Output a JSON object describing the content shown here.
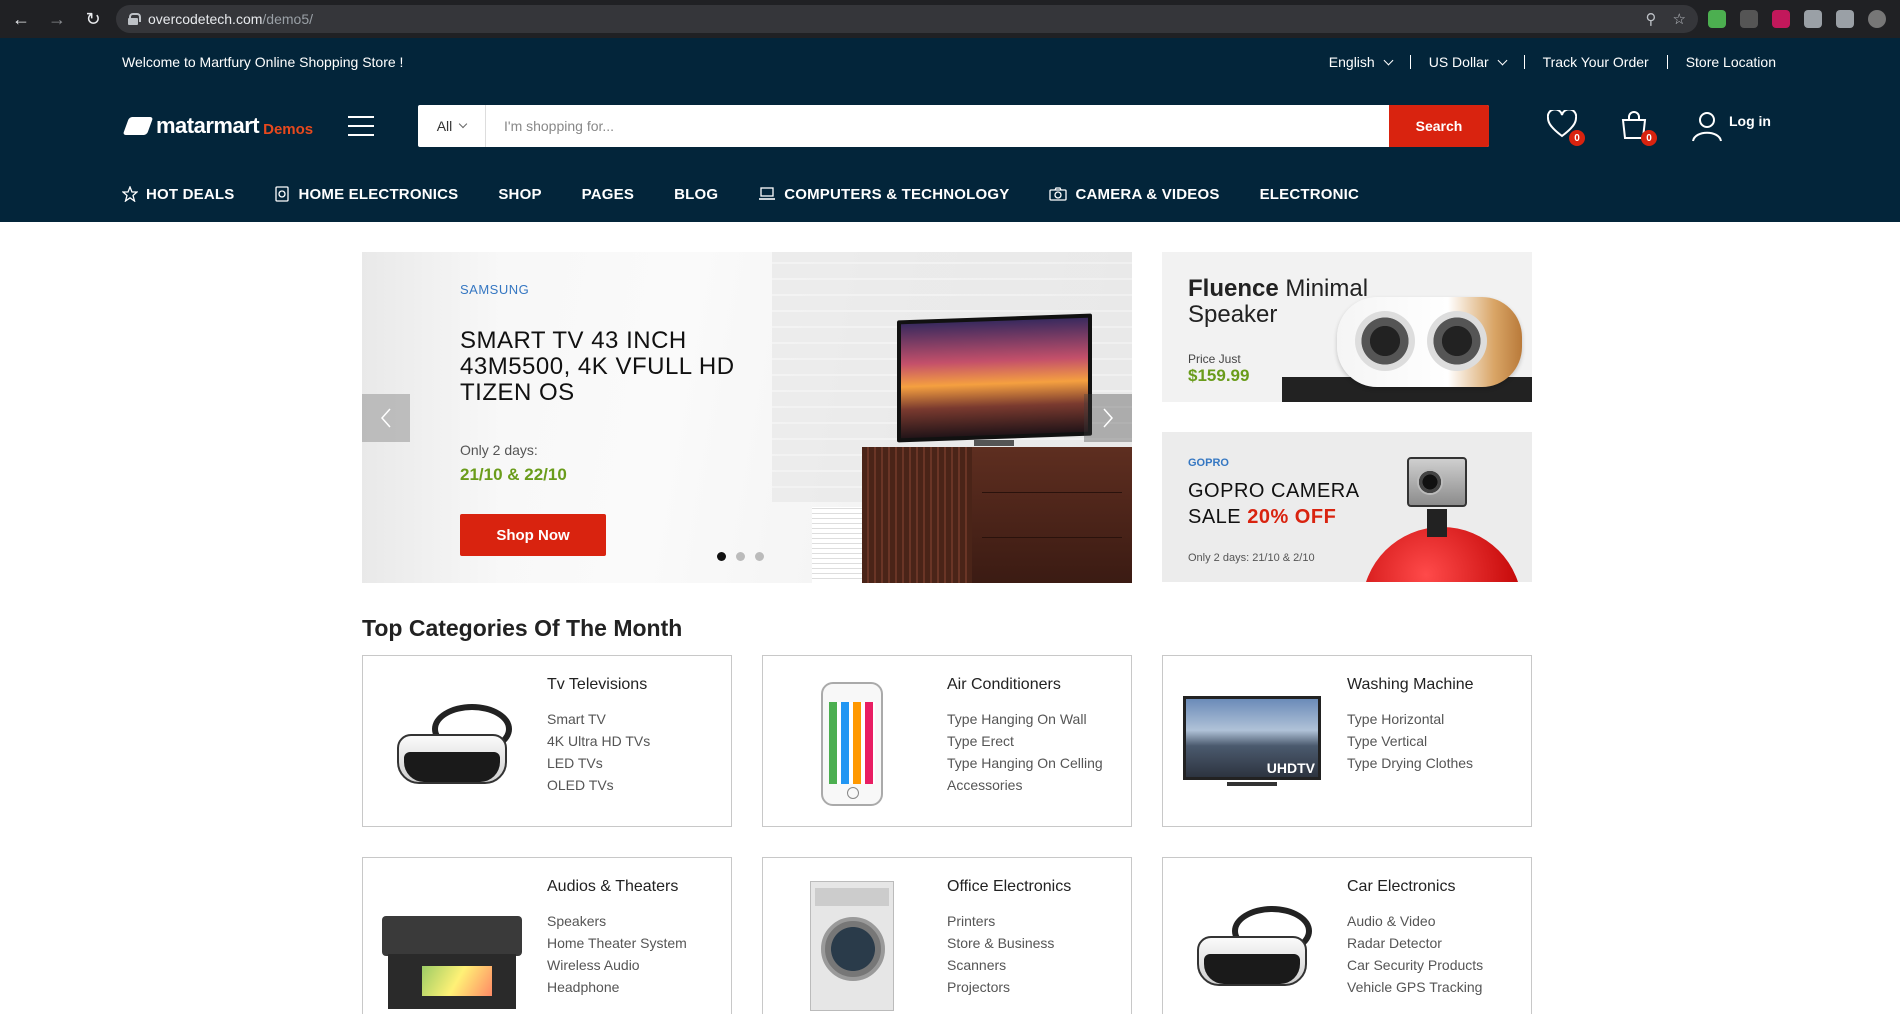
{
  "browser": {
    "url_host": "overcodetech.com",
    "url_path": "/demo5/"
  },
  "topbar": {
    "welcome": "Welcome to Martfury Online Shopping Store !",
    "language": "English",
    "currency": "US Dollar",
    "track": "Track Your Order",
    "store": "Store Location"
  },
  "header": {
    "logo_text": "matarmart",
    "logo_suffix": "Demos",
    "search_category": "All",
    "search_placeholder": "I'm shopping for...",
    "search_button": "Search",
    "wishlist_count": "0",
    "cart_count": "0",
    "login": "Log in"
  },
  "nav": [
    {
      "label": "HOT DEALS",
      "icon": "star-icon"
    },
    {
      "label": "HOME ELECTRONICS",
      "icon": "device-icon"
    },
    {
      "label": "SHOP",
      "icon": ""
    },
    {
      "label": "PAGES",
      "icon": ""
    },
    {
      "label": "BLOG",
      "icon": ""
    },
    {
      "label": "COMPUTERS & TECHNOLOGY",
      "icon": "laptop-icon"
    },
    {
      "label": "CAMERA & VIDEOS",
      "icon": "camera-icon"
    },
    {
      "label": "ELECTRONIC",
      "icon": ""
    }
  ],
  "hero": {
    "brand": "SAMSUNG",
    "title": "SMART TV 43 INCH 43M5500, 4K VFULL HD TIZEN OS",
    "only": "Only 2 days:",
    "dates": "21/10 & 22/10",
    "button": "Shop Now"
  },
  "promo1": {
    "title_bold": "Fluence",
    "title_rest": " Minimal Speaker",
    "price_label": "Price Just",
    "price": "$159.99"
  },
  "promo2": {
    "brand": "GOPRO",
    "title_line1": "GOPRO CAMERA",
    "title_line2": "SALE ",
    "discount": "20% OFF",
    "only": "Only 2 days: 21/10 & 2/10"
  },
  "categories_title": "Top Categories Of The Month",
  "categories": [
    {
      "name": "Tv Televisions",
      "items": [
        "Smart TV",
        "4K Ultra HD TVs",
        "LED TVs",
        "OLED TVs"
      ]
    },
    {
      "name": "Air Conditioners",
      "items": [
        "Type Hanging On Wall",
        "Type Erect",
        "Type Hanging On Celling",
        "Accessories"
      ]
    },
    {
      "name": "Washing Machine",
      "items": [
        "Type Horizontal",
        "Type Vertical",
        "Type Drying Clothes"
      ]
    },
    {
      "name": "Audios & Theaters",
      "items": [
        "Speakers",
        "Home Theater System",
        "Wireless Audio",
        "Headphone"
      ]
    },
    {
      "name": "Office Electronics",
      "items": [
        "Printers",
        "Store & Business",
        "Scanners",
        "Projectors"
      ]
    },
    {
      "name": "Car Electronics",
      "items": [
        "Audio & Video",
        "Radar Detector",
        "Car Security Products",
        "Vehicle GPS Tracking"
      ]
    }
  ],
  "tv_badge": "UHDTV",
  "colors": {
    "header_bg": "#03253a",
    "accent": "#d9230f",
    "green": "#6a9c1b",
    "link_blue": "#3577c2"
  }
}
